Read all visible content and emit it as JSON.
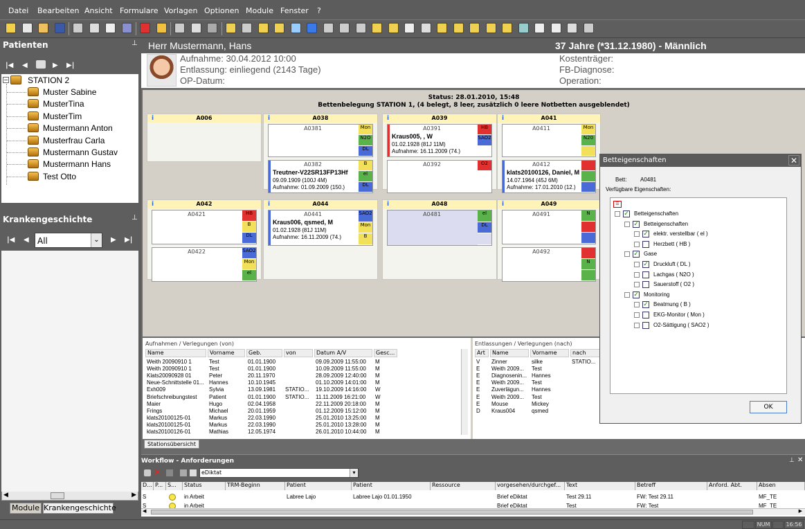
{
  "menu": [
    "Datei",
    "Bearbeiten",
    "Ansicht",
    "Formulare",
    "Vorlagen",
    "Optionen",
    "Module",
    "Fenster",
    "?"
  ],
  "patients_panel": {
    "title": "Patienten",
    "station": "STATION 2",
    "patients": [
      "Muster Sabine",
      "MusterTina",
      "MusterTim",
      "Mustermann Anton",
      "Musterfrau Carla",
      "Mustermann Gustav",
      "Mustermann Hans",
      "Test Otto"
    ]
  },
  "history_panel": {
    "title": "Krankengeschichte",
    "filter": "All",
    "tabs": [
      "Module",
      "Krankengeschichte"
    ]
  },
  "patient_header": {
    "name": "Herr Mustermann, Hans",
    "age_sex": "37 Jahre (*31.12.1980) - Männlich",
    "aufnahme": "Aufnahme: 30.04.2012 10:00",
    "entlassung": "Entlassung: einliegend (2143 Tage)",
    "op_datum": "OP-Datum:",
    "kostentraeger": "Kostenträger:",
    "fb_diagnose": "FB-Diagnose:",
    "operation": "Operation:"
  },
  "station_view": {
    "status": "Status: 28.01.2010, 15:48",
    "summary": "Bettenbelegung STATION 1, (4 belegt, 8 leer, zusätzlich 0 leere Notbetten ausgeblendet)",
    "rooms": [
      {
        "id": "A006",
        "beds": []
      },
      {
        "id": "A038",
        "beds": [
          {
            "id": "A0381",
            "patient": "",
            "dob": "",
            "admission": "",
            "tags": [
              {
                "t": "Mon",
                "c": "#f3e05a"
              },
              {
                "t": "N2O",
                "c": "#5ab34a"
              },
              {
                "t": "DL",
                "c": "#4a6ad8"
              }
            ]
          },
          {
            "id": "A0382",
            "patient": "Treutner-V22SR13FP13Hf",
            "dob": "09.09.1909  (100J  4M)",
            "admission": "Aufnahme: 01.09.2009  (150.)",
            "tags": [
              {
                "t": "B",
                "c": "#f3e05a"
              },
              {
                "t": "el",
                "c": "#5ab34a"
              },
              {
                "t": "DL",
                "c": "#4a6ad8"
              }
            ]
          }
        ]
      },
      {
        "id": "A039",
        "beds": [
          {
            "id": "A0391",
            "patient": "Kraus005, , W",
            "dob": "01.02.1928  (81J 11M)",
            "admission": "Aufnahme: 16.11.2009 (74.)",
            "tags": [
              {
                "t": "HB",
                "c": "#e03030"
              },
              {
                "t": "SAO2",
                "c": "#4a6ad8"
              },
              {
                "t": "",
                "c": "#ffffff"
              }
            ]
          },
          {
            "id": "A0392",
            "patient": "",
            "dob": "",
            "admission": "",
            "tags": [
              {
                "t": "O2",
                "c": "#e03030"
              },
              {
                "t": "",
                "c": "#ffffff"
              },
              {
                "t": "",
                "c": "#ffffff"
              }
            ]
          }
        ]
      },
      {
        "id": "A041",
        "beds": [
          {
            "id": "A0411",
            "patient": "",
            "dob": "",
            "admission": "",
            "tags": [
              {
                "t": "Mon",
                "c": "#f3e05a"
              },
              {
                "t": "N20",
                "c": "#5ab34a"
              },
              {
                "t": "",
                "c": "#f3e05a"
              }
            ]
          },
          {
            "id": "A0412",
            "patient": "klats20100126, Daniel, M",
            "dob": "14.07.1964  (45J 6M)",
            "admission": "Aufnahme: 17.01.2010 (12.)",
            "tags": [
              {
                "t": "",
                "c": "#e03030"
              },
              {
                "t": "",
                "c": "#5ab34a"
              },
              {
                "t": "",
                "c": "#4a6ad8"
              }
            ]
          }
        ]
      },
      {
        "id": "A042",
        "beds": [
          {
            "id": "A0421",
            "patient": "",
            "dob": "",
            "admission": "",
            "tags": [
              {
                "t": "HB",
                "c": "#e03030"
              },
              {
                "t": "B",
                "c": "#f3e05a"
              },
              {
                "t": "DL",
                "c": "#4a6ad8"
              }
            ]
          },
          {
            "id": "A0422",
            "patient": "",
            "dob": "",
            "admission": "",
            "tags": [
              {
                "t": "SAO2",
                "c": "#4a6ad8"
              },
              {
                "t": "Mon",
                "c": "#f3e05a"
              },
              {
                "t": "el",
                "c": "#5ab34a"
              }
            ]
          }
        ]
      },
      {
        "id": "A044",
        "beds": [
          {
            "id": "A0441",
            "patient": "Kraus006, qsmed, M",
            "dob": "01.02.1928  (81J 11M)",
            "admission": "Aufnahme: 16.11.2009 (74.)",
            "tags": [
              {
                "t": "SAO2",
                "c": "#4a6ad8"
              },
              {
                "t": "Mon",
                "c": "#f3e05a"
              },
              {
                "t": "B",
                "c": "#f3e05a"
              }
            ]
          }
        ]
      },
      {
        "id": "A048",
        "beds": [
          {
            "id": "A0481",
            "patient": "",
            "dob": "",
            "admission": "",
            "tags": [
              {
                "t": "el",
                "c": "#5ab34a"
              },
              {
                "t": "DL",
                "c": "#4a6ad8"
              },
              {
                "t": "",
                "c": "#dcdcf0"
              }
            ]
          }
        ]
      },
      {
        "id": "A049",
        "beds": [
          {
            "id": "A0491",
            "patient": "",
            "dob": "",
            "admission": "",
            "tags": [
              {
                "t": "N",
                "c": "#5ab34a"
              },
              {
                "t": "",
                "c": "#e03030"
              },
              {
                "t": "",
                "c": "#4a6ad8"
              }
            ]
          },
          {
            "id": "A0492",
            "patient": "",
            "dob": "",
            "admission": "",
            "tags": [
              {
                "t": "",
                "c": "#e03030"
              },
              {
                "t": "N",
                "c": "#5ab34a"
              },
              {
                "t": "",
                "c": "#5ab34a"
              }
            ]
          }
        ]
      }
    ],
    "tab": "Stationsübersicht"
  },
  "admissions": {
    "title": "Aufnahmen / Verlegungen (von)",
    "columns": [
      "Name",
      "Vorname",
      "Geb.",
      "von",
      "Datum A/V",
      "Gesc..."
    ],
    "rows": [
      [
        "Weith 20090910 1",
        "Test",
        "01.01.1900",
        "",
        "09.09.2009 11:55:00",
        "M"
      ],
      [
        "Weith 20090910 1",
        "Test",
        "01.01.1900",
        "",
        "10.09.2009 11:55:00",
        "M"
      ],
      [
        "Klats20090928 01",
        "Peter",
        "20.11.1970",
        "",
        "28.09.2009 12:40:00",
        "M"
      ],
      [
        "Neue-Schnittstelle 01...",
        "Hannes",
        "10.10.1945",
        "",
        "01.10.2009 14:01:00",
        "M"
      ],
      [
        "Exh009",
        "Sylvia",
        "13.09.1981",
        "STATIO...",
        "19.10.2009 14:16:00",
        "W"
      ],
      [
        "Briefschreibungstest",
        "Patient",
        "01.01.1900",
        "STATIO...",
        "11.11.2009 16:21:00",
        "W"
      ],
      [
        "Maier",
        "Hugo",
        "02.04.1958",
        "",
        "22.11.2009 20:18:00",
        "M"
      ],
      [
        "Frings",
        "Michael",
        "20.01.1959",
        "",
        "01.12.2009 15:12:00",
        "M"
      ],
      [
        "klats20100125-01",
        "Markus",
        "22.03.1990",
        "",
        "25.01.2010 13:25:00",
        "M"
      ],
      [
        "klats20100125-01",
        "Markus",
        "22.03.1990",
        "",
        "25.01.2010 13:28:00",
        "M"
      ],
      [
        "klats20100126-01",
        "Mathias",
        "12.05.1974",
        "",
        "26.01.2010 10:44:00",
        "M"
      ]
    ]
  },
  "discharges": {
    "title": "Entlassungen / Verlegungen (nach)",
    "columns": [
      "Art",
      "Name",
      "Vorname",
      "nach"
    ],
    "rows": [
      [
        "V",
        "Zinner",
        "silke",
        "STATIO..."
      ],
      [
        "E",
        "Weith 2009...",
        "Test",
        ""
      ],
      [
        "E",
        "Diagnosenin...",
        "Hannes",
        ""
      ],
      [
        "E",
        "Weith 2009...",
        "Test",
        ""
      ],
      [
        "E",
        "Zuverlägun...",
        "Hannes",
        ""
      ],
      [
        "E",
        "Weith 2009...",
        "Test",
        ""
      ],
      [
        "E",
        "Mouse",
        "Mickey",
        ""
      ],
      [
        "D",
        "Kraus004",
        "qsmed",
        ""
      ]
    ]
  },
  "dialog": {
    "title": "Betteigenschaften",
    "bed_label": "Bett:",
    "bed_value": "A0481",
    "avail_label": "Verfügbare Eigenschaften:",
    "root": "Betteigenschaften",
    "groups": [
      {
        "name": "Betteigenschaften",
        "items": [
          {
            "label": "elektr. verstellbar ( el )",
            "checked": true
          },
          {
            "label": "Herzbett ( HB )",
            "checked": false
          }
        ]
      },
      {
        "name": "Gase",
        "items": [
          {
            "label": "Druckluft ( DL )",
            "checked": true
          },
          {
            "label": "Lachgas ( N2O )",
            "checked": false
          },
          {
            "label": "Sauerstoff ( O2 )",
            "checked": false
          }
        ]
      },
      {
        "name": "Monitoring",
        "items": [
          {
            "label": "Beatmung ( B )",
            "checked": true
          },
          {
            "label": "EKG-Monitor ( Mon )",
            "checked": false
          },
          {
            "label": "O2-Sättigung ( SAO2 )",
            "checked": false
          }
        ]
      }
    ],
    "ok": "OK"
  },
  "workflow": {
    "title": "Workflow - Anforderungen",
    "filter": "eDiktat",
    "columns": [
      "D...",
      "P...",
      "S...",
      "Status",
      "TRM-Beginn",
      "Patient",
      "Patient",
      "Ressource",
      "vorgesehen/durchgef...",
      "Text",
      "Betreff",
      "Anford. Abt.",
      "Absen"
    ],
    "rows": [
      [
        "S",
        "",
        "",
        "in Arbeit",
        "",
        "Labree Lajo",
        "Labree Lajo 01.01.1950",
        "",
        "Brief eDiktat",
        "Test 29.11",
        "FW: Test 29.11",
        "",
        "MF_TE"
      ],
      [
        "S",
        "",
        "",
        "in Arbeit",
        "",
        "",
        "",
        "",
        "Brief eDiktat",
        "Test",
        "FW: Test",
        "",
        "MF_TE"
      ]
    ]
  },
  "statusbar": {
    "num": "NUM",
    "time": "16:56"
  },
  "colors": {
    "panel": "#5e5e5e",
    "hl_yellow": "#fff3b8",
    "selected_bed": "#dcdcf0"
  }
}
